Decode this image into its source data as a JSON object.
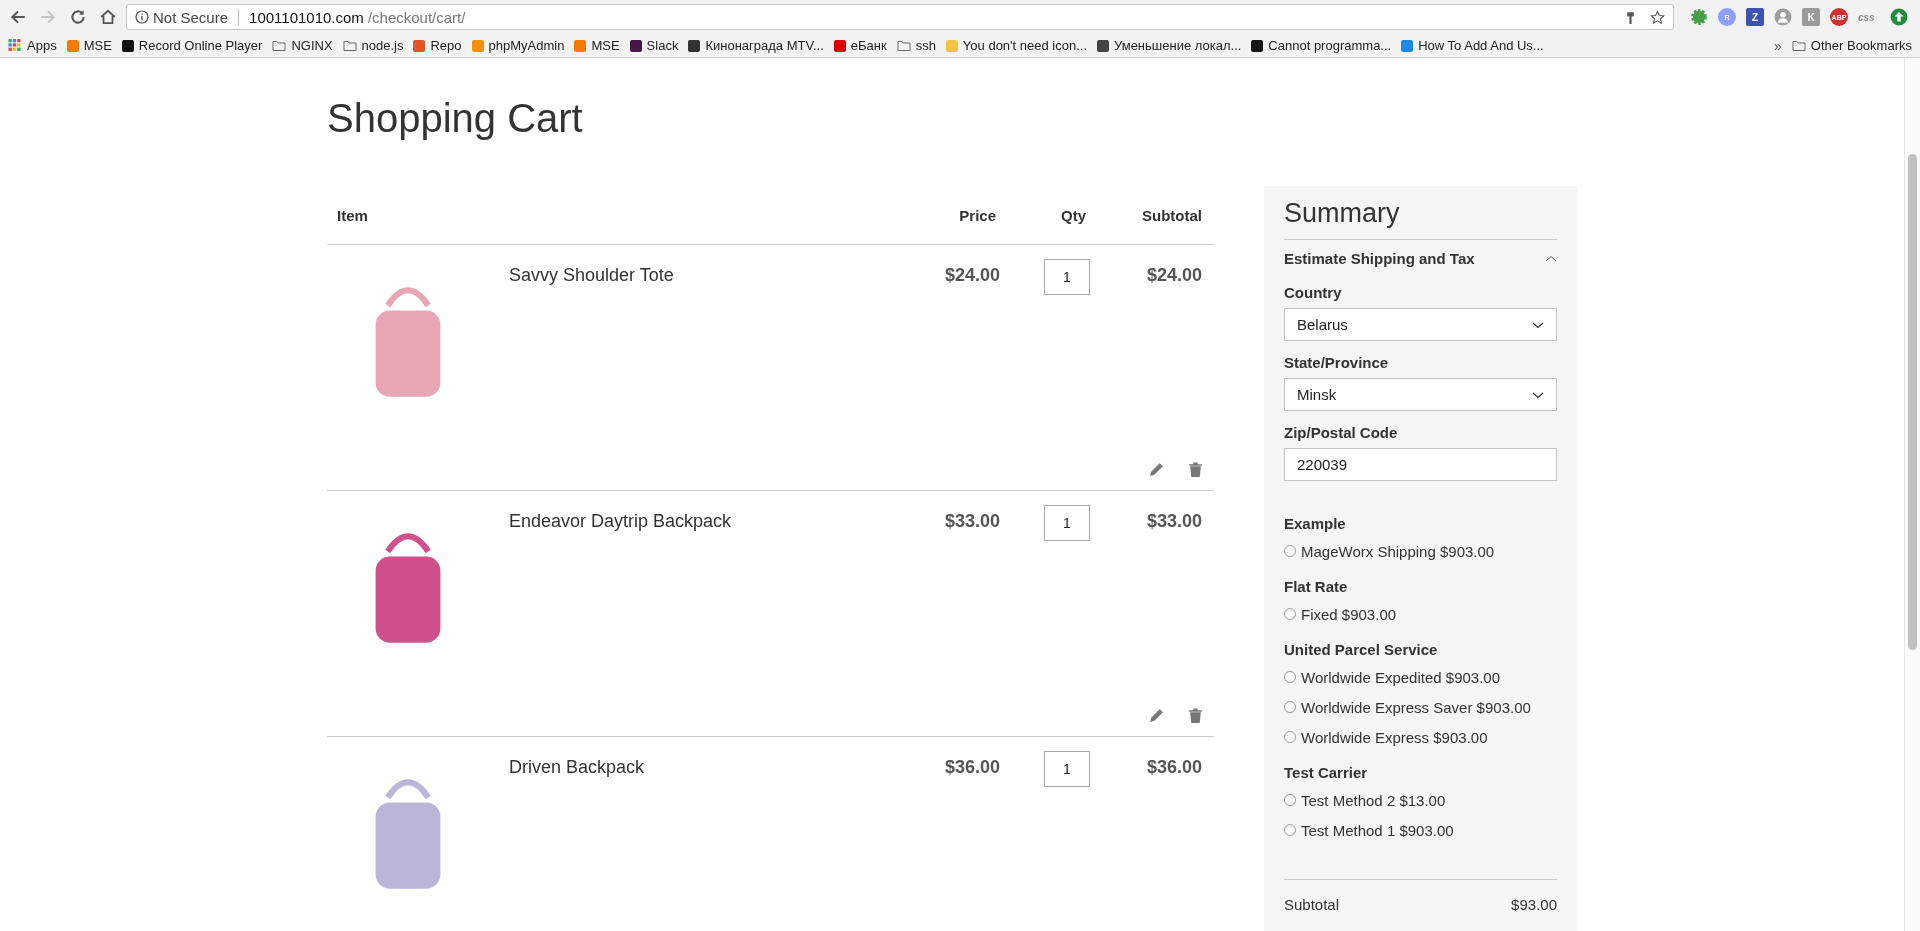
{
  "browser": {
    "security": "Not Secure",
    "url_host": "1001101010.com",
    "url_path": "/checkout/cart/",
    "forward_disabled": true
  },
  "extensions": [
    {
      "kind": "gear",
      "color": "#43a047"
    },
    {
      "kind": "letter",
      "label": "R",
      "color": "#8c9eff"
    },
    {
      "kind": "letter",
      "label": "Z",
      "color": "#3f51b5"
    },
    {
      "kind": "person",
      "color": "#9e9e9e"
    },
    {
      "kind": "letter",
      "label": "K",
      "color": "#9a9a9a"
    },
    {
      "kind": "letter",
      "label": "ABP",
      "color": "#d32f2f"
    },
    {
      "kind": "text",
      "label": "css",
      "color": "#888888"
    },
    {
      "kind": "arrow",
      "color": "#1e8e3e"
    }
  ],
  "bookmarks": [
    {
      "label": "Apps",
      "kind": "apps"
    },
    {
      "label": "MSE",
      "kind": "site",
      "color": "#f57c00"
    },
    {
      "label": "Record Online Player",
      "kind": "site",
      "color": "#111111"
    },
    {
      "label": "NGINX",
      "kind": "folder"
    },
    {
      "label": "node.js",
      "kind": "folder"
    },
    {
      "label": "Repo",
      "kind": "site",
      "color": "#e65528"
    },
    {
      "label": "phpMyAdmin",
      "kind": "site",
      "color": "#f29111"
    },
    {
      "label": "MSE",
      "kind": "site",
      "color": "#f57c00"
    },
    {
      "label": "Slack",
      "kind": "site",
      "color": "#4a154b"
    },
    {
      "label": "Кинонаграда MTV...",
      "kind": "site",
      "color": "#333333"
    },
    {
      "label": "еБанк",
      "kind": "site",
      "color": "#e00000"
    },
    {
      "label": "ssh",
      "kind": "folder"
    },
    {
      "label": "You don't need icon...",
      "kind": "site",
      "color": "#f4c542"
    },
    {
      "label": "Уменьшение локал...",
      "kind": "site",
      "color": "#444444"
    },
    {
      "label": "Cannot programma...",
      "kind": "site",
      "color": "#181717"
    },
    {
      "label": "How To Add And Us...",
      "kind": "site",
      "color": "#1e88e5"
    }
  ],
  "bookmarks_more": "»",
  "other_bookmarks": "Other Bookmarks",
  "page": {
    "title": "Shopping Cart",
    "columns": [
      "Item",
      "Price",
      "Qty",
      "Subtotal"
    ],
    "items": [
      {
        "name": "Savvy Shoulder Tote",
        "price": "$24.00",
        "qty": "1",
        "subtotal": "$24.00",
        "color": "#e8a6b4"
      },
      {
        "name": "Endeavor Daytrip Backpack",
        "price": "$33.00",
        "qty": "1",
        "subtotal": "$33.00",
        "color": "#d0508e"
      },
      {
        "name": "Driven Backpack",
        "price": "$36.00",
        "qty": "1",
        "subtotal": "$36.00",
        "color": "#b9b6d8"
      }
    ],
    "summary": {
      "title": "Summary",
      "section": "Estimate Shipping and Tax",
      "expanded": true,
      "fields": [
        {
          "label": "Country",
          "value": "Belarus",
          "kind": "select"
        },
        {
          "label": "State/Province",
          "value": "Minsk",
          "kind": "select"
        },
        {
          "label": "Zip/Postal Code",
          "value": "220039",
          "kind": "text"
        }
      ],
      "carriers": [
        {
          "title": "Example",
          "methods": [
            {
              "label": "MageWorx Shipping $903.00",
              "selected": false
            }
          ]
        },
        {
          "title": "Flat Rate",
          "methods": [
            {
              "label": "Fixed $903.00",
              "selected": false
            }
          ]
        },
        {
          "title": "United Parcel Service",
          "methods": [
            {
              "label": "Worldwide Expedited $903.00",
              "selected": false
            },
            {
              "label": "Worldwide Express Saver $903.00",
              "selected": false
            },
            {
              "label": "Worldwide Express $903.00",
              "selected": false
            }
          ]
        },
        {
          "title": "Test Carrier",
          "methods": [
            {
              "label": "Test Method 2 $13.00",
              "selected": false
            },
            {
              "label": "Test Method 1 $903.00",
              "selected": false
            }
          ]
        }
      ],
      "totals": [
        {
          "label": "Subtotal",
          "value": "$93.00"
        }
      ]
    }
  }
}
